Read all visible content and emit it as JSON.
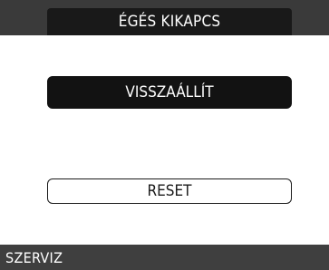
{
  "header": {
    "title": "ÉGÉS KIKAPCS"
  },
  "main": {
    "restore_label": "VISSZAÁLLÍT",
    "reset_label": "RESET"
  },
  "footer": {
    "label": "SZERVIZ"
  },
  "colors": {
    "header_strip": "#3a3a3a",
    "header_tab": "#191919",
    "primary_button": "#121212",
    "footer_bar": "#3f3f3f",
    "background": "#ffffff"
  }
}
